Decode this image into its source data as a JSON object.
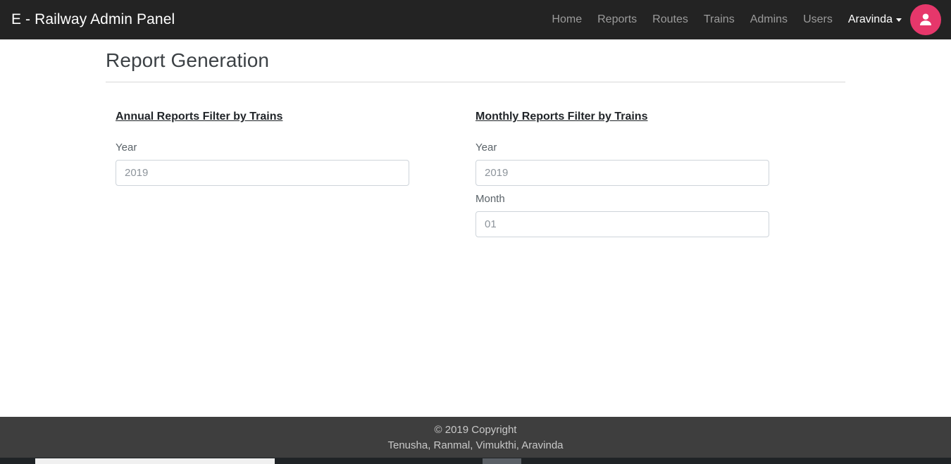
{
  "navbar": {
    "brand": "E - Railway Admin Panel",
    "links": [
      {
        "label": "Home"
      },
      {
        "label": "Reports"
      },
      {
        "label": "Routes"
      },
      {
        "label": "Trains"
      },
      {
        "label": "Admins"
      },
      {
        "label": "Users"
      }
    ],
    "user": {
      "name": "Aravinda",
      "caret_icon": "chevron-down-icon",
      "avatar_icon": "user-avatar-icon"
    },
    "colors": {
      "background": "#232323",
      "link": "#9b9b9b",
      "avatar": "#e6376b"
    }
  },
  "main": {
    "page_title": "Report Generation",
    "annual": {
      "section_title": "Annual Reports Filter by Trains",
      "year_label": "Year",
      "year_value": "2019",
      "year_placeholder": "2019"
    },
    "monthly": {
      "section_title": "Monthly Reports Filter by Trains",
      "year_label": "Year",
      "year_value": "2019",
      "year_placeholder": "2019",
      "month_label": "Month",
      "month_value": "01",
      "month_placeholder": "01"
    }
  },
  "footer": {
    "copyright": "© 2019 Copyright",
    "authors": "Tenusha, Ranmal, Vimukthi, Aravinda",
    "colors": {
      "background": "#3e3e3e",
      "text": "#c9c9c9"
    }
  }
}
